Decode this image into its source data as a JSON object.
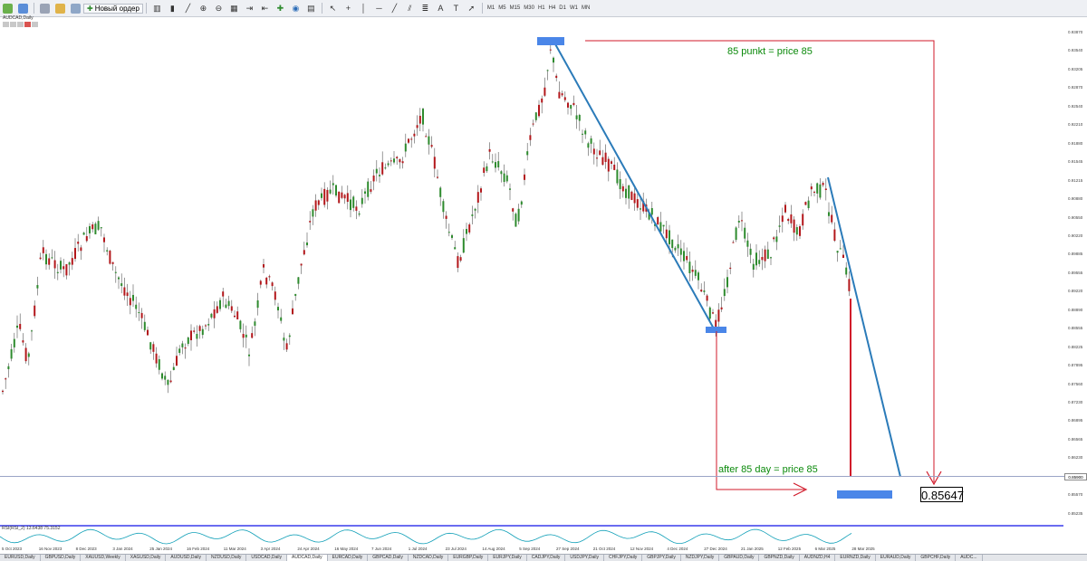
{
  "toolbar": {
    "new_order_label": "Новый ордер",
    "timeframes": [
      "M1",
      "M5",
      "M15",
      "M30",
      "H1",
      "H4",
      "D1",
      "W1",
      "MN"
    ]
  },
  "chart": {
    "title": "AUDCAD,Daily",
    "price_labels": [
      "0.93870",
      "0.93540",
      "0.93205",
      "0.92870",
      "0.92540",
      "0.92210",
      "0.91880",
      "0.91545",
      "0.91215",
      "0.90880",
      "0.90550",
      "0.90220",
      "0.89885",
      "0.89555",
      "0.89220",
      "0.88890",
      "0.88555",
      "0.88225",
      "0.87895",
      "0.87560",
      "0.87230",
      "0.86895",
      "0.86565",
      "0.86230",
      "0.85900",
      "0.85570",
      "0.85235"
    ],
    "current_price": "0.85900",
    "time_labels": [
      "5 Oct 2023",
      "16 Nov 2023",
      "8 Dec 2023",
      "3 Jan 2024",
      "25 Jan 2024",
      "16 Feb 2024",
      "11 Mar 2024",
      "3 Apr 2024",
      "24 Apr 2024",
      "16 May 2024",
      "7 Jun 2024",
      "1 Jul 2024",
      "23 Jul 2024",
      "14 Aug 2024",
      "5 Sep 2024",
      "27 Sep 2024",
      "21 Oct 2024",
      "12 Nov 2024",
      "4 Dec 2024",
      "27 Dec 2024",
      "21 Jan 2025",
      "12 Feb 2025",
      "6 Mar 2025",
      "28 Mar 2025"
    ],
    "indicator_label": "RSI(RSI_2) 13.6438 75.3152",
    "colors": {
      "bull": "#2e8b2e",
      "bear": "#b3171b",
      "wick": "#555555",
      "trendline": "#2b7bb9",
      "arrow": "#d11a2a",
      "highlight": "#4a86e8",
      "annotation": "#0b8a0b",
      "indicator": "#12a0b8"
    }
  },
  "annotations": {
    "top_text": "85 punkt = price 85",
    "bottom_text": "after 85 day = price 85",
    "target_price": "0.85647"
  },
  "tabs": [
    "EURUSD,Daily",
    "GBPUSD,Daily",
    "XAUUSD,Weekly",
    "XAGUSD,Daily",
    "AUDUSD,Daily",
    "NZDUSD,Daily",
    "USDCAD,Daily",
    "AUDCAD,Daily",
    "EURCAD,Daily",
    "GBPCAD,Daily",
    "NZDCAD,Daily",
    "EURGBP,Daily",
    "EURJPY,Daily",
    "CADJPY,Daily",
    "USDJPY,Daily",
    "CHFJPY,Daily",
    "GBPJPY,Daily",
    "NZDJPY,Daily",
    "GBPAUD,Daily",
    "GBPNZD,Daily",
    "AUDNZD,H4",
    "EURNZD,Daily",
    "EURAUD,Daily",
    "GBPCHF,Daily",
    "AUDC..."
  ],
  "active_tab_index": 7
}
